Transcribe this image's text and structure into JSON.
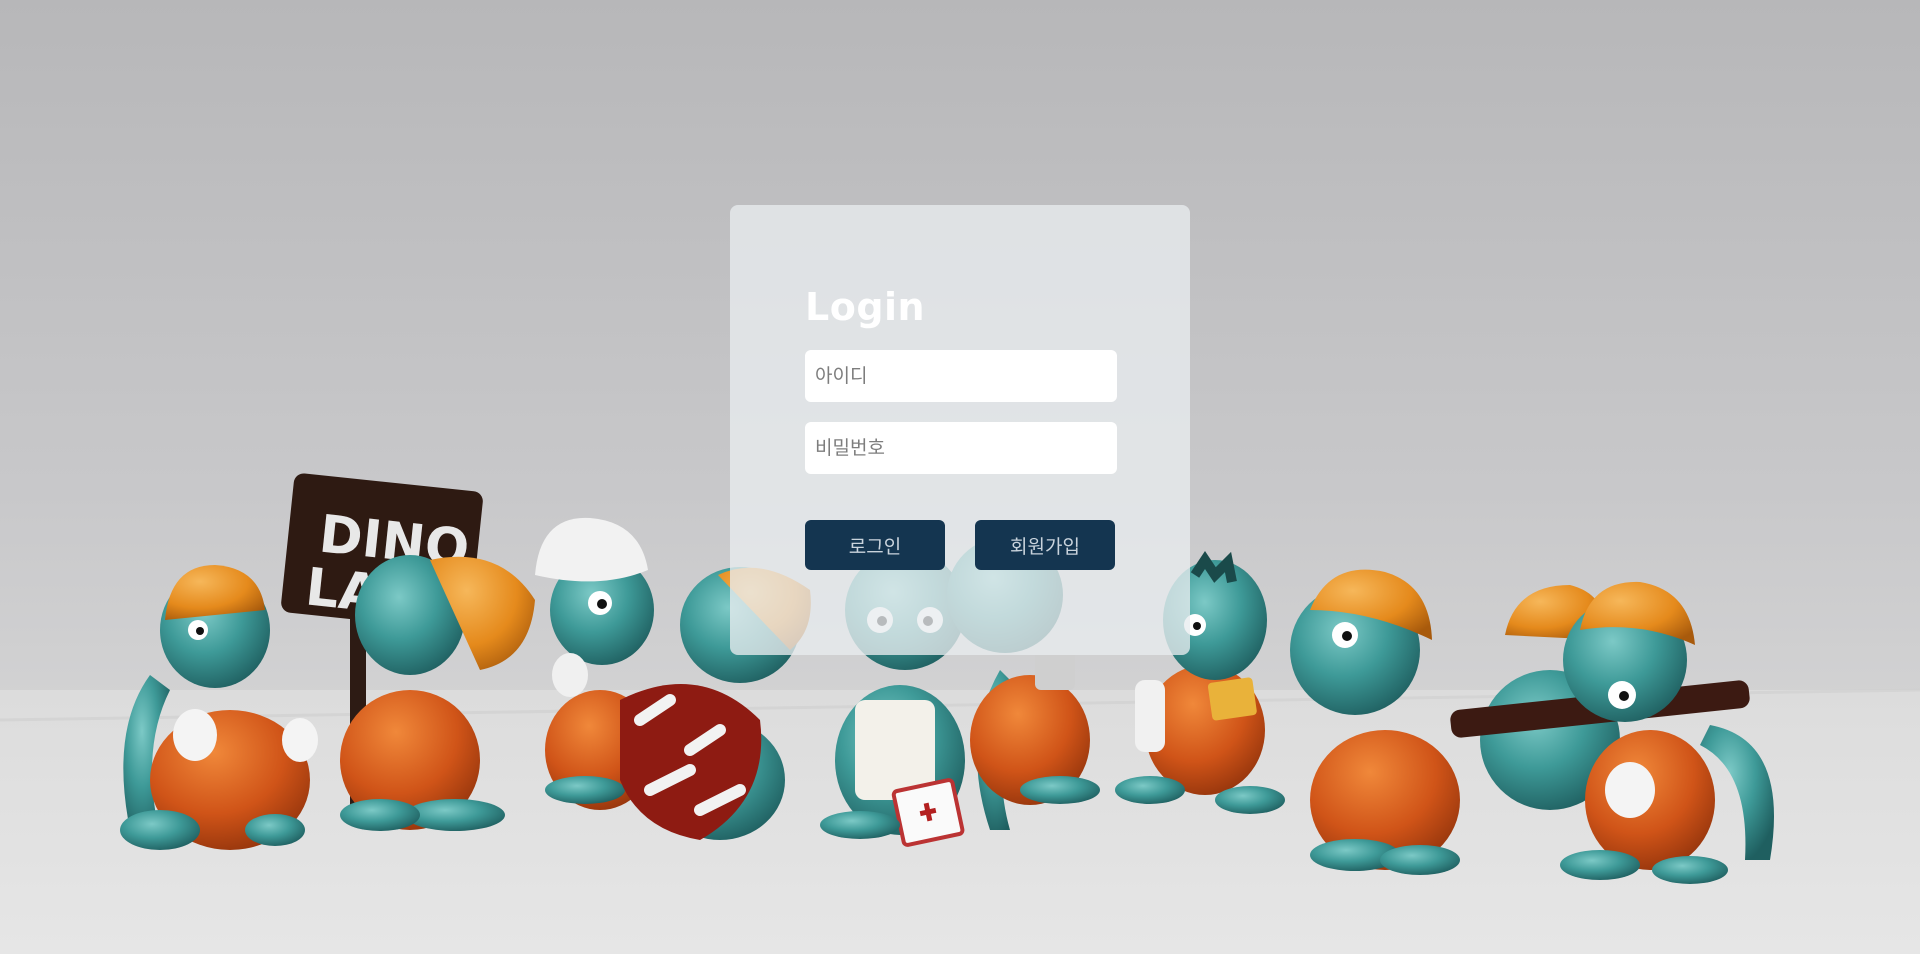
{
  "login": {
    "title": "Login",
    "id_placeholder": "아이디",
    "password_placeholder": "비밀번호",
    "login_button": "로그인",
    "signup_button": "회원가입"
  },
  "background": {
    "sign_line1": "DINO",
    "sign_line2": "LAND"
  },
  "colors": {
    "button_bg": "#143550",
    "button_text": "#c9d3dc",
    "dino_teal": "#3e9a98",
    "overalls_orange": "#d05418",
    "helmet_orange": "#e58a1c"
  }
}
